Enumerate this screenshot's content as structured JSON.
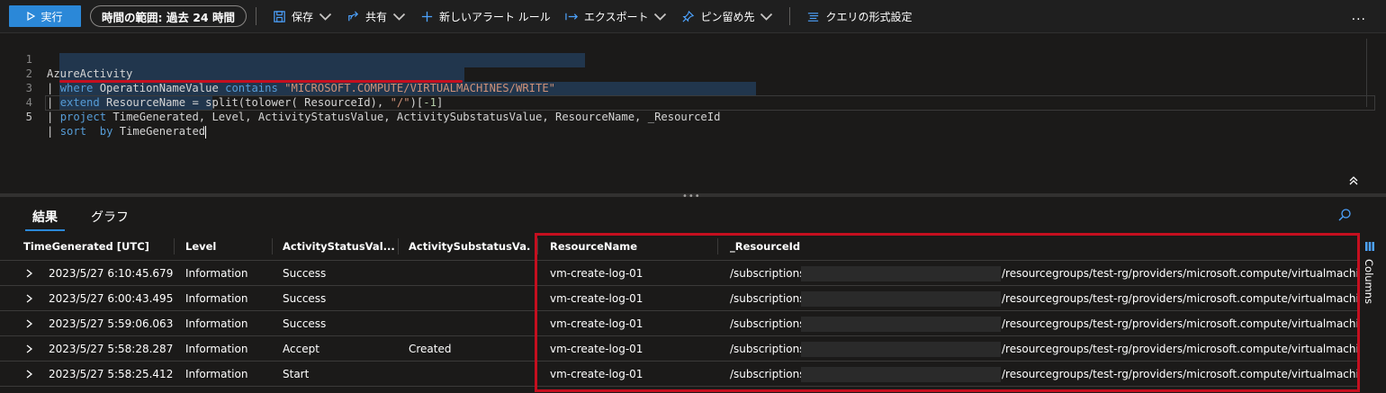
{
  "toolbar": {
    "run_label": "実行",
    "time_range_label": "時間の範囲: 過去 24 時間",
    "save_label": "保存",
    "share_label": "共有",
    "new_alert_label": "新しいアラート ルール",
    "export_label": "エクスポート",
    "pin_label": "ピン留め先",
    "format_label": "クエリの形式設定",
    "more_label": "..."
  },
  "editor": {
    "line_numbers": [
      "1",
      "2",
      "3",
      "4",
      "5"
    ],
    "lines": {
      "l1": "AzureActivity",
      "l2_pipe": "| ",
      "l2_kw1": "where",
      "l2_mid": " OperationNameValue ",
      "l2_kw2": "contains",
      "l2_str": "\"MICROSOFT.COMPUTE/VIRTUALMACHINES/WRITE\"",
      "l3_pipe": "| ",
      "l3_kw": "extend",
      "l3_mid": " ResourceName = split(tolower( ResourceId), ",
      "l3_str": "\"/\"",
      "l3_br": ")[",
      "l3_num": "-1",
      "l3_end": "]",
      "l4_pipe": "| ",
      "l4_kw": "project",
      "l4_rest": " TimeGenerated, Level, ActivityStatusValue, ActivitySubstatusValue, ResourceName, _ResourceId",
      "l5_pipe": "| ",
      "l5_kw": "sort",
      "l5_sp": "  ",
      "l5_kw2": "by",
      "l5_rest": " TimeGenerated"
    }
  },
  "tabs": {
    "results": "結果",
    "chart": "グラフ"
  },
  "grid": {
    "headers": [
      "TimeGenerated [UTC]",
      "Level",
      "ActivityStatusVal...",
      "ActivitySubstatusVa...",
      "ResourceName",
      "_ResourceId"
    ],
    "rows": [
      [
        "2023/5/27 6:10:45.679",
        "Information",
        "Success",
        "",
        "vm-create-log-01",
        "/subscriptions/",
        "/resourcegroups/test-rg/providers/microsoft.compute/virtualmachines/vm"
      ],
      [
        "2023/5/27 6:00:43.495",
        "Information",
        "Success",
        "",
        "vm-create-log-01",
        "/subscriptions/",
        "/resourcegroups/test-rg/providers/microsoft.compute/virtualmachines/vm"
      ],
      [
        "2023/5/27 5:59:06.063",
        "Information",
        "Success",
        "",
        "vm-create-log-01",
        "/subscriptions/",
        "/resourcegroups/test-rg/providers/microsoft.compute/virtualmachines/vm"
      ],
      [
        "2023/5/27 5:58:28.287",
        "Information",
        "Accept",
        "Created",
        "vm-create-log-01",
        "/subscriptions/",
        "/resourcegroups/test-rg/providers/microsoft.compute/virtualmachines/vm"
      ],
      [
        "2023/5/27 5:58:25.412",
        "Information",
        "Start",
        "",
        "vm-create-log-01",
        "/subscriptions/",
        "/resourcegroups/test-rg/providers/microsoft.compute/virtualmachines/vm"
      ]
    ]
  },
  "side": {
    "columns_label": "Columns"
  },
  "colors": {
    "accent": "#2b88d8",
    "highlight_red": "#c50f1f",
    "background": "#1b1a19"
  }
}
